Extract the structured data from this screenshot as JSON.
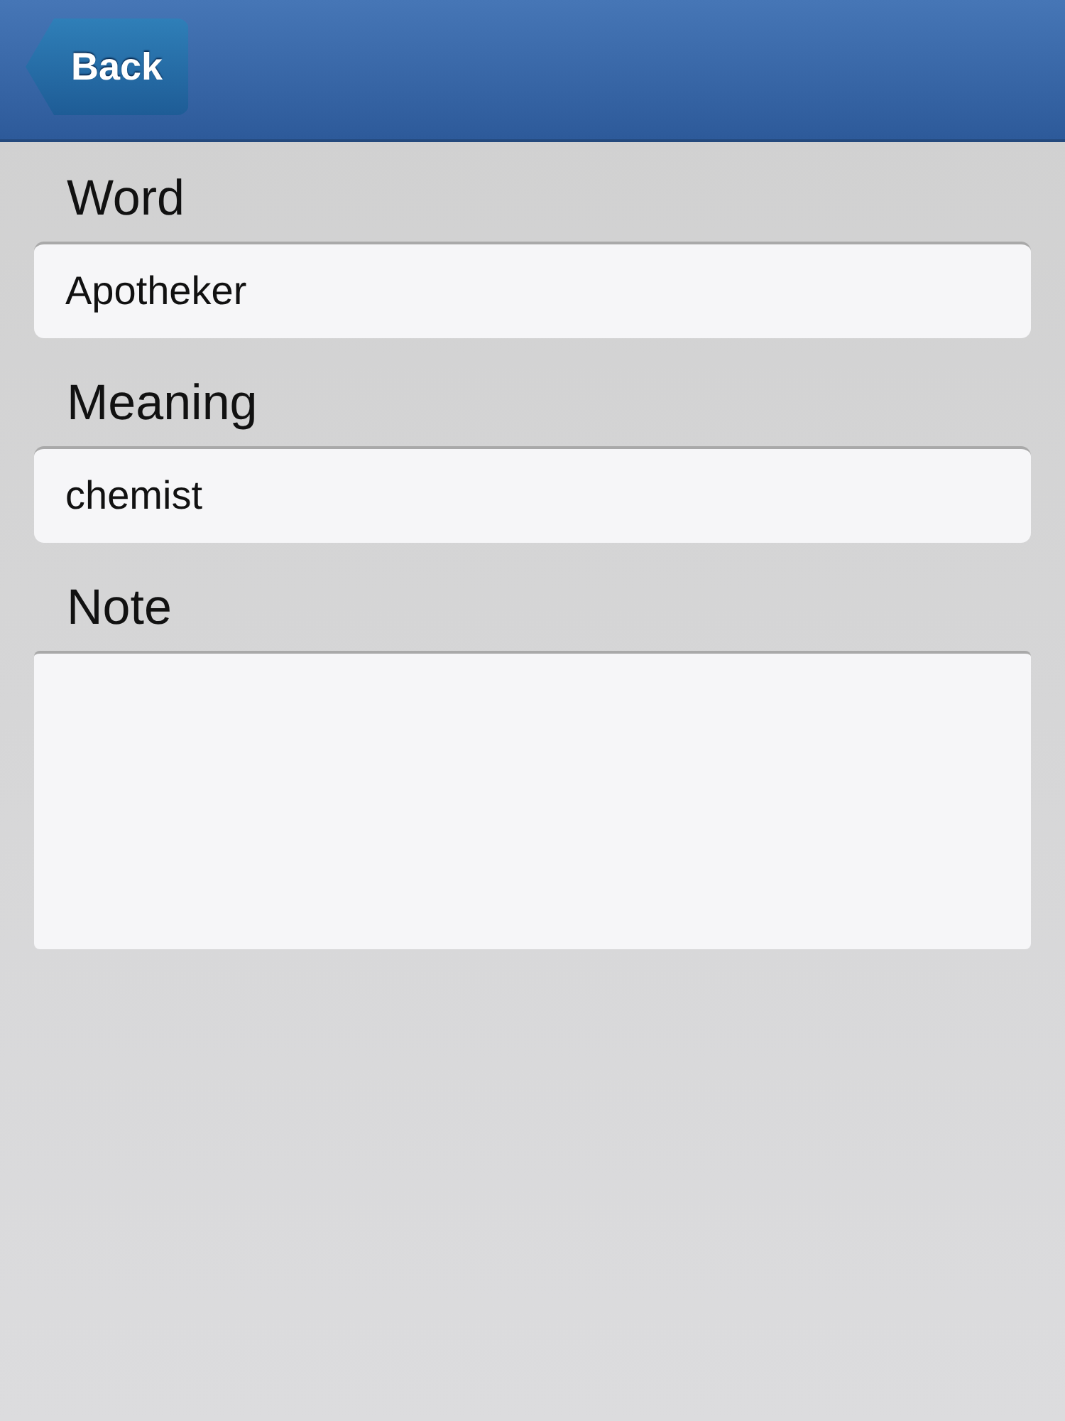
{
  "header": {
    "back_button": "Back"
  },
  "fields": [
    {
      "label": "Word",
      "kind": "input",
      "value": "Apotheker"
    },
    {
      "label": "Meaning",
      "kind": "input",
      "value": "chemist"
    },
    {
      "label": "Note",
      "kind": "textarea"
    }
  ]
}
